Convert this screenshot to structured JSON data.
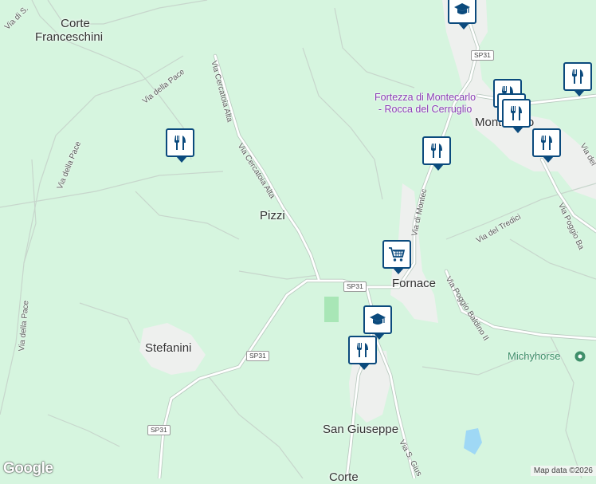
{
  "colors": {
    "land": "#d6f5df",
    "road": "#ffffff",
    "road_edge": "#b9c9bf",
    "town": "#eef0ee",
    "park": "#a8e6b6",
    "water": "#9fd8f5",
    "marker_border": "#0b4a7d",
    "poi_text": "#8a3db5"
  },
  "places": {
    "corte_franceschini_1": "Corte",
    "corte_franceschini_2": "Franceschini",
    "pizzi": "Pizzi",
    "stefanini": "Stefanini",
    "fornace": "Fornace",
    "san_giuseppe": "San Giuseppe",
    "corte_bottom": "Corte",
    "montecarlo": "Montecarlo"
  },
  "roads": {
    "via_di_s_top": "Via di S.",
    "via_della_pace_1": "Via della Pace",
    "via_della_pace_2": "Via della Pace",
    "via_della_pace_3": "Via della Pace",
    "via_cercatoia_alta_1": "Via Cercatoia Alta",
    "via_cercatoia_alta_2": "Via Cercatoia Alta",
    "via_di_montecarlo": "Via di Montec",
    "via_del_tredici": "Via del Tredici",
    "via_poggio_baldino": "Via Poggio Baldino II",
    "via_poggio_b": "Via Poggio Ba",
    "via_del_right": "Via del",
    "via_s_gius": "Via S. Gius"
  },
  "shields": {
    "sp31_top": "SP31",
    "sp31_mid": "SP31",
    "sp31_left": "SP31",
    "sp31_bottom": "SP31"
  },
  "pois": {
    "fortezza_line1": "Fortezza di Montecarlo",
    "fortezza_line2": "- Rocca del Cerruglio",
    "michyhorse": "Michyhorse"
  },
  "markers": [
    {
      "kind": "restaurant",
      "icon": "fork-knife-icon"
    },
    {
      "kind": "restaurant",
      "icon": "fork-knife-icon"
    },
    {
      "kind": "restaurant",
      "icon": "fork-knife-icon"
    },
    {
      "kind": "restaurant",
      "icon": "fork-knife-icon"
    },
    {
      "kind": "restaurant",
      "icon": "fork-knife-icon"
    },
    {
      "kind": "restaurant",
      "icon": "fork-knife-icon"
    },
    {
      "kind": "restaurant",
      "icon": "fork-knife-icon"
    },
    {
      "kind": "shopping",
      "icon": "shopping-cart-icon"
    },
    {
      "kind": "school",
      "icon": "graduation-cap-icon"
    },
    {
      "kind": "school",
      "icon": "graduation-cap-icon"
    }
  ],
  "footer": {
    "logo": "Google",
    "attribution": "Map data ©2026"
  }
}
